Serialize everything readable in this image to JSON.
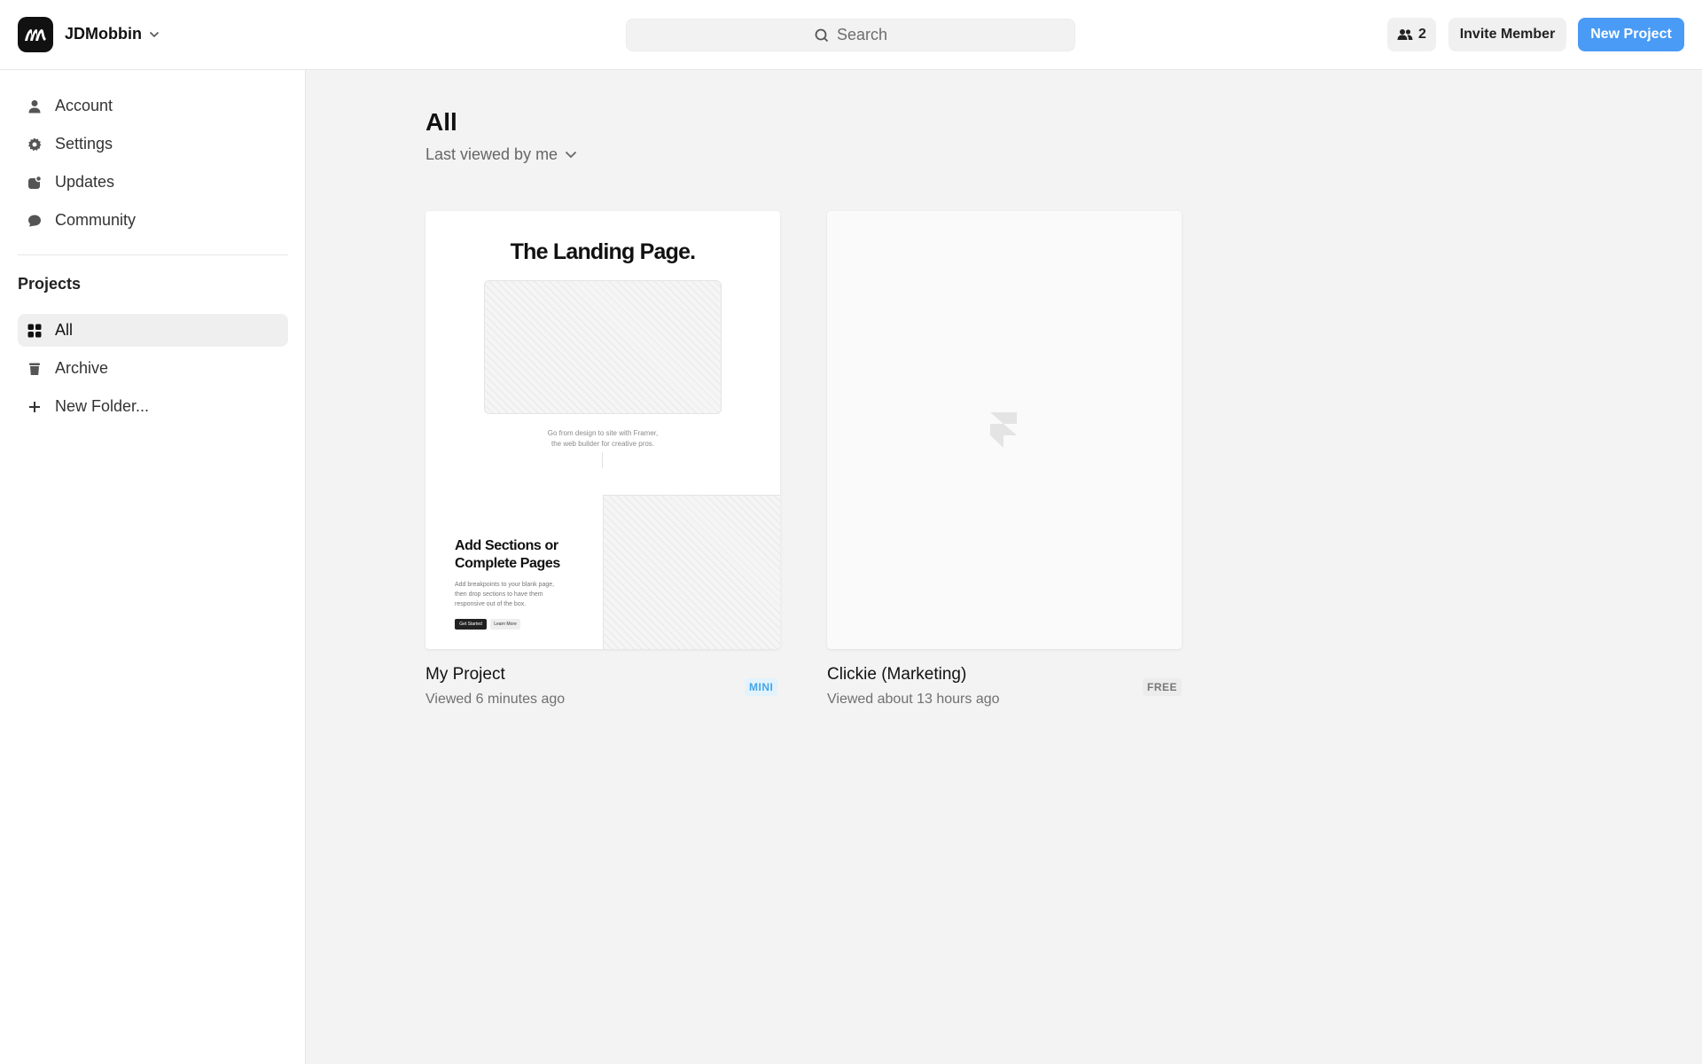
{
  "header": {
    "workspace_name": "JDMobbin",
    "search_placeholder": "Search",
    "member_count": "2",
    "invite_label": "Invite Member",
    "new_project_label": "New Project",
    "accent_color": "#4a9bf5"
  },
  "sidebar": {
    "items": [
      {
        "label": "Account",
        "icon": "user-icon"
      },
      {
        "label": "Settings",
        "icon": "gear-icon"
      },
      {
        "label": "Updates",
        "icon": "updates-icon"
      },
      {
        "label": "Community",
        "icon": "chat-bubble-icon"
      }
    ],
    "projects_title": "Projects",
    "project_items": [
      {
        "label": "All",
        "icon": "grid-icon",
        "active": true
      },
      {
        "label": "Archive",
        "icon": "trash-icon"
      },
      {
        "label": "New Folder...",
        "icon": "plus-icon"
      }
    ]
  },
  "main": {
    "title": "All",
    "sort_label": "Last viewed by me",
    "projects": [
      {
        "name": "My Project",
        "viewed": "Viewed 6 minutes ago",
        "plan": "MINI",
        "thumbnail": {
          "title": "The Landing Page.",
          "caption_line1": "Go from design to site with Framer,",
          "caption_line2": "the web builder for creative pros.",
          "heading_line1": "Add Sections or",
          "heading_line2": "Complete Pages",
          "body_line1": "Add breakpoints to your blank page,",
          "body_line2": "then drop sections to have them",
          "body_line3": "responsive out of the box.",
          "primary_button": "Get Started",
          "secondary_button": "Learn More"
        }
      },
      {
        "name": "Clickie (Marketing)",
        "viewed": "Viewed about 13 hours ago",
        "plan": "FREE",
        "thumbnail_icon": "framer-logo-icon"
      }
    ]
  }
}
